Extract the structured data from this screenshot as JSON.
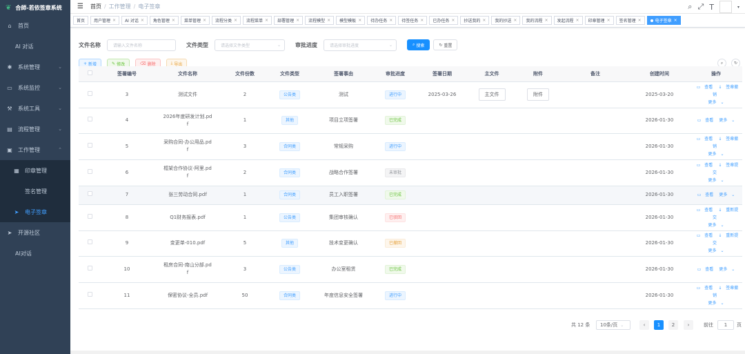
{
  "app": {
    "title": "合師-若依签章系统"
  },
  "sidebar": {
    "items": [
      {
        "label": "首页",
        "icon": "home-icon"
      },
      {
        "label": "AI 对话",
        "icon": ""
      },
      {
        "label": "系统管理",
        "icon": "gear-icon",
        "arrow": "chevron-down"
      },
      {
        "label": "系统监控",
        "icon": "monitor-icon",
        "arrow": "chevron-down"
      },
      {
        "label": "系统工具",
        "icon": "tool-icon",
        "arrow": "chevron-down"
      },
      {
        "label": "流程管理",
        "icon": "flow-icon",
        "arrow": "chevron-down"
      },
      {
        "label": "工作管理",
        "icon": "work-icon",
        "arrow": "chevron-up"
      },
      {
        "label": "印章管理",
        "icon": "seal-icon"
      },
      {
        "label": "签名管理",
        "icon": "sign-icon"
      },
      {
        "label": "电子签章",
        "icon": "send-icon"
      },
      {
        "label": "开源社区",
        "icon": "send-icon"
      },
      {
        "label": "AI对话",
        "icon": ""
      }
    ]
  },
  "breadcrumb": {
    "home": "首页",
    "level1": "工作管理",
    "level2": "电子签章"
  },
  "tags": [
    "首页",
    "用户管理",
    "AI 对话",
    "角色管理",
    "菜单管理",
    "流程分类",
    "流程菜单",
    "部署管理",
    "流程模型",
    "模型模板",
    "待办任务",
    "待签任务",
    "已办任务",
    "抄送我的",
    "我的抄送",
    "我的流程",
    "发起流程",
    "印章管理",
    "签名管理",
    "电子签章"
  ],
  "search": {
    "file_name_label": "文件名称",
    "file_name_placeholder": "请输入文件名称",
    "file_type_label": "文件类型",
    "file_type_placeholder": "请选择文件类型",
    "progress_label": "审批进度",
    "progress_placeholder": "请选择审批进度",
    "search_button": "搜索",
    "reset_button": "重置"
  },
  "toolbar": {
    "add": "新增",
    "edit": "修改",
    "delete": "删除",
    "export": "导出"
  },
  "table": {
    "headers": [
      "签署编号",
      "文件名称",
      "文件份数",
      "文件类型",
      "签署事由",
      "审批进度",
      "签署日期",
      "主文件",
      "附件",
      "备注",
      "创建时间",
      "操作"
    ],
    "rows": [
      {
        "id": "3",
        "name": "测试文件",
        "copies": "2",
        "type": "公告类",
        "reason": "测试",
        "progress": "进行中",
        "date": "2025-03-26",
        "main": "主文件",
        "attach": "附件",
        "created": "2025-03-20",
        "op1": "查看",
        "op2": "签章撤销",
        "more": "更多"
      },
      {
        "id": "4",
        "name": "2026年度研发计划.pdf",
        "copies": "1",
        "type": "其他",
        "reason": "项目立项签署",
        "progress": "已完成",
        "date": "",
        "main": "",
        "attach": "",
        "created": "2026-01-30",
        "op1": "查看",
        "op2": "",
        "more": "更多"
      },
      {
        "id": "5",
        "name": "采购合同-办公用品.pdf",
        "copies": "3",
        "type": "合同类",
        "reason": "常规采购",
        "progress": "进行中",
        "date": "",
        "main": "",
        "attach": "",
        "created": "2026-01-30",
        "op1": "查看",
        "op2": "签章撤销",
        "more": "更多"
      },
      {
        "id": "6",
        "name": "框架合作协议-阿里.pdf",
        "copies": "2",
        "type": "合同类",
        "reason": "战略合作签署",
        "progress": "未审批",
        "date": "",
        "main": "",
        "attach": "",
        "created": "2026-01-30",
        "op1": "查看",
        "op2": "签章提交",
        "more": "更多"
      },
      {
        "id": "7",
        "name": "张三劳动合同.pdf",
        "copies": "1",
        "type": "合同类",
        "reason": "员工入职签署",
        "progress": "已完成",
        "date": "",
        "main": "",
        "attach": "",
        "created": "2026-01-30",
        "op1": "查看",
        "op2": "",
        "more": "更多"
      },
      {
        "id": "8",
        "name": "Q1财务报表.pdf",
        "copies": "1",
        "type": "公告类",
        "reason": "集团审核确认",
        "progress": "已驳回",
        "date": "",
        "main": "",
        "attach": "",
        "created": "2026-01-30",
        "op1": "查看",
        "op2": "重新提交",
        "more": "更多"
      },
      {
        "id": "9",
        "name": "变更单-010.pdf",
        "copies": "5",
        "type": "其他",
        "reason": "技术变更确认",
        "progress": "已撤回",
        "date": "",
        "main": "",
        "attach": "",
        "created": "2026-01-30",
        "op1": "查看",
        "op2": "重新提交",
        "more": "更多"
      },
      {
        "id": "10",
        "name": "租房合同-南山分部.pdf",
        "copies": "3",
        "type": "公告类",
        "reason": "办公室租赁",
        "progress": "已完成",
        "date": "",
        "main": "",
        "attach": "",
        "created": "2026-01-30",
        "op1": "查看",
        "op2": "",
        "more": "更多"
      },
      {
        "id": "11",
        "name": "保密协议-全员.pdf",
        "copies": "50",
        "type": "合同类",
        "reason": "年度信息安全签署",
        "progress": "进行中",
        "date": "",
        "main": "",
        "attach": "",
        "created": "2026-01-30",
        "op1": "查看",
        "op2": "签章撤销",
        "more": "更多"
      }
    ]
  },
  "pagination": {
    "total": "共 12 条",
    "page_size": "10条/页",
    "pages": [
      "1",
      "2"
    ],
    "goto_label": "前往",
    "goto_value": "1",
    "page_unit": "页"
  }
}
